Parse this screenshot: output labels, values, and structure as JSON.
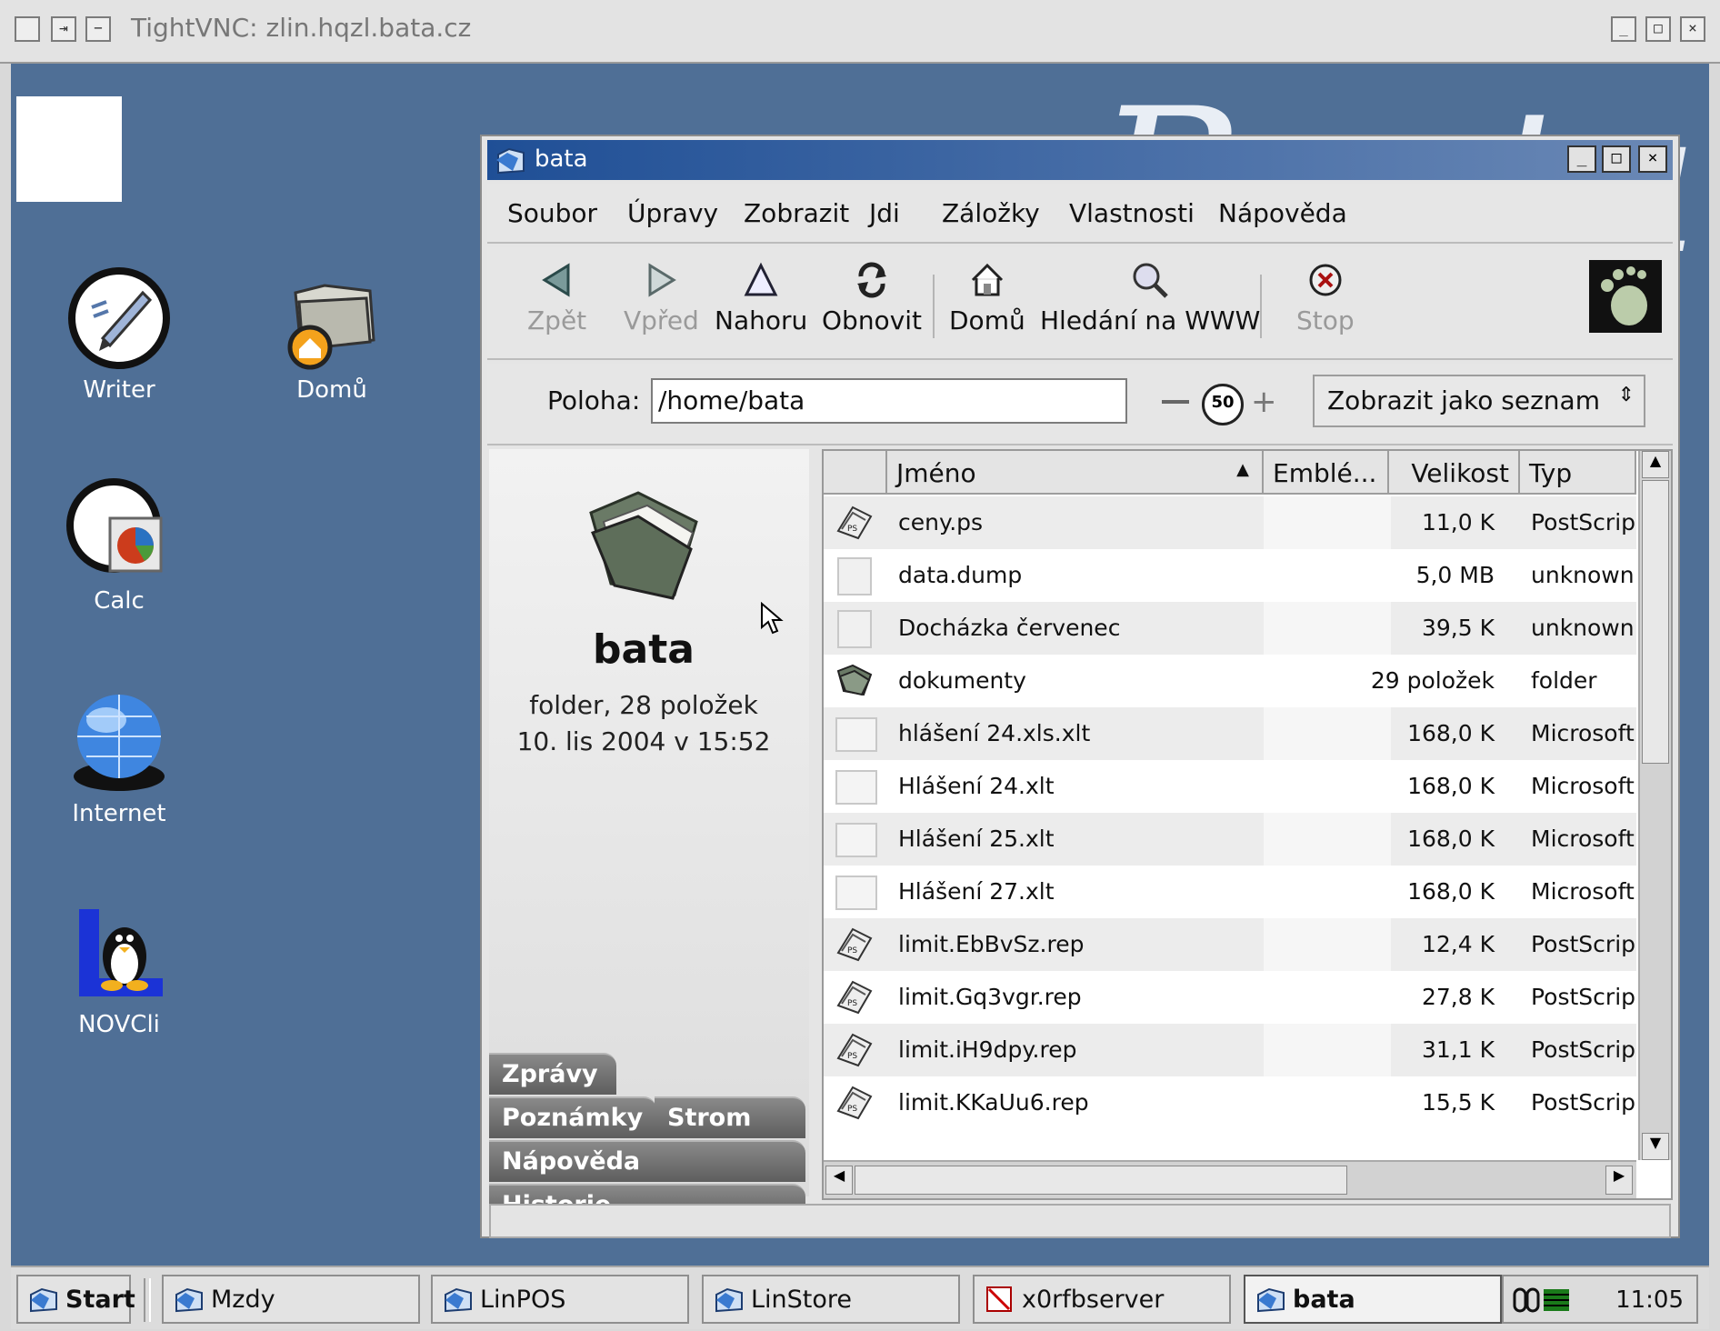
{
  "vnc": {
    "title": "TightVNC: zlin.hqzl.bata.cz"
  },
  "desktop": {
    "icons": [
      {
        "label": "Writer",
        "icon": "writer-icon"
      },
      {
        "label": "Domů",
        "icon": "home-folder-icon"
      },
      {
        "label": "Calc",
        "icon": "calc-icon"
      },
      {
        "label": "Internet",
        "icon": "globe-icon"
      },
      {
        "label": "NOVCli",
        "icon": "tux-icon"
      }
    ]
  },
  "window": {
    "title": "bata",
    "menu": [
      "Soubor",
      "Úpravy",
      "Zobrazit",
      "Jdi",
      "Záložky",
      "Vlastnosti",
      "Nápověda"
    ],
    "toolbar": {
      "back": "Zpět",
      "forward": "Vpřed",
      "up": "Nahoru",
      "reload": "Obnovit",
      "home": "Domů",
      "search": "Hledání na WWW",
      "stop": "Stop"
    },
    "location": {
      "label": "Poloha:",
      "value": "/home/bata",
      "zoom": "50",
      "view_mode": "Zobrazit jako seznam"
    },
    "sidebar": {
      "name": "bata",
      "info_line1": "folder, 28 položek",
      "info_line2": "10. lis 2004 v 15:52",
      "tabs": [
        "Zprávy",
        "Poznámky",
        "Strom",
        "Nápověda",
        "Historie"
      ]
    },
    "columns": {
      "name": "Jméno",
      "emblems": "Emblé...",
      "size": "Velikost",
      "type": "Typ"
    },
    "files": [
      {
        "name": "ceny.ps",
        "size": "11,0 K",
        "type": "PostScript",
        "icon": "postscript-icon"
      },
      {
        "name": "data.dump",
        "size": "5,0 MB",
        "type": "unknown t",
        "icon": "file-icon"
      },
      {
        "name": "Docházka červenec",
        "size": "39,5 K",
        "type": "unknown t",
        "icon": "file-icon"
      },
      {
        "name": "dokumenty",
        "size": "29 položek",
        "type": "folder",
        "icon": "folder-icon"
      },
      {
        "name": "hlášení 24.xls.xlt",
        "size": "168,0 K",
        "type": "Microsoft",
        "icon": "spreadsheet-icon"
      },
      {
        "name": "Hlášení 24.xlt",
        "size": "168,0 K",
        "type": "Microsoft",
        "icon": "spreadsheet-icon"
      },
      {
        "name": "Hlášení 25.xlt",
        "size": "168,0 K",
        "type": "Microsoft",
        "icon": "spreadsheet-icon"
      },
      {
        "name": "Hlášení 27.xlt",
        "size": "168,0 K",
        "type": "Microsoft",
        "icon": "spreadsheet-icon"
      },
      {
        "name": "limit.EbBvSz.rep",
        "size": "12,4 K",
        "type": "PostScript",
        "icon": "postscript-icon"
      },
      {
        "name": "limit.Gq3vgr.rep",
        "size": "27,8 K",
        "type": "PostScript",
        "icon": "postscript-icon"
      },
      {
        "name": "limit.iH9dpy.rep",
        "size": "31,1 K",
        "type": "PostScript",
        "icon": "postscript-icon"
      },
      {
        "name": "limit.KKaUu6.rep",
        "size": "15,5 K",
        "type": "PostScript",
        "icon": "postscript-icon"
      }
    ]
  },
  "taskbar": {
    "start": "Start",
    "tasks": [
      "Mzdy",
      "LinPOS",
      "LinStore",
      "x0rfbserver",
      "bata"
    ],
    "clock": "11:05"
  }
}
